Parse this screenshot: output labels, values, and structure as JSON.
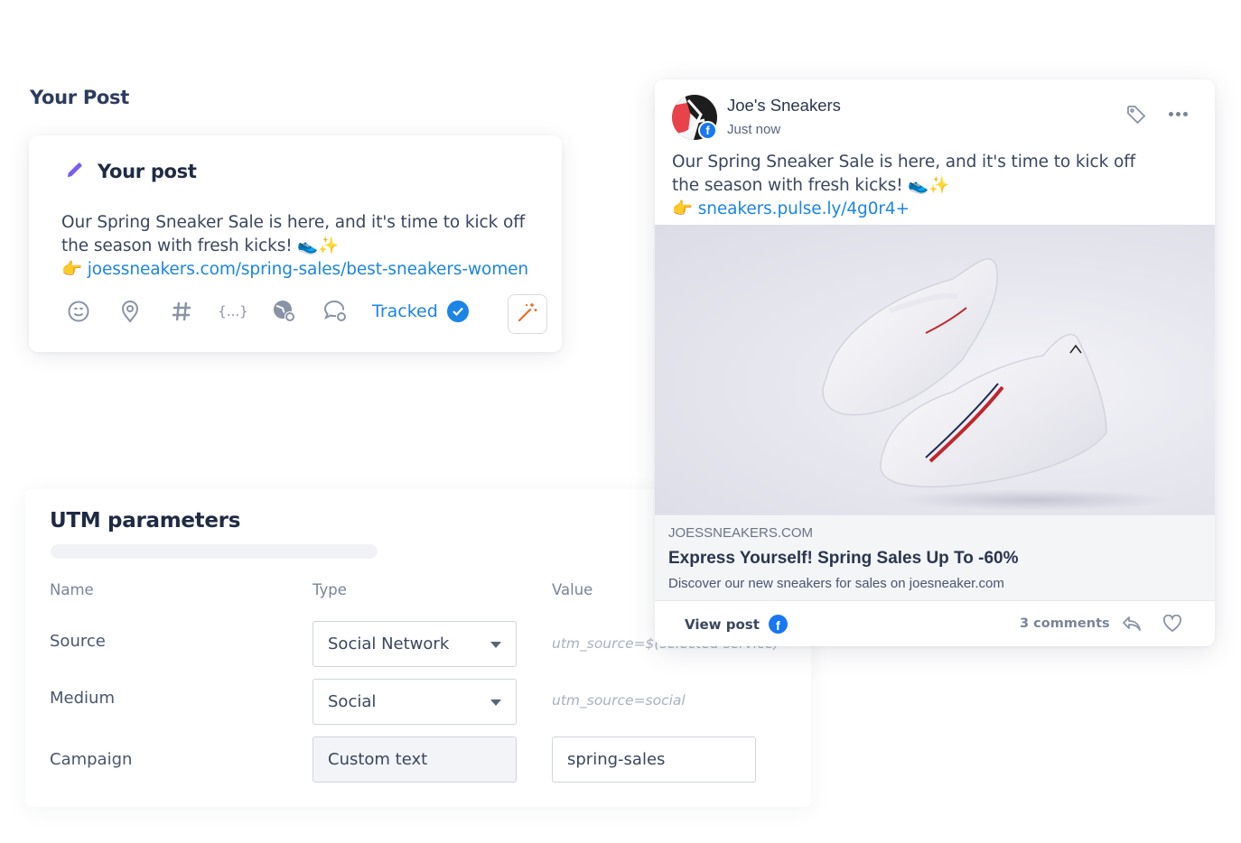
{
  "section": {
    "title": "Your Post"
  },
  "composer": {
    "title": "Your post",
    "text_line1": "Our Spring Sneaker Sale is here, and it's time to kick off",
    "text_line2": "the season with fresh kicks! 👟✨",
    "link_prefix": "👉",
    "link": "joessneakers.com/spring-sales/best-sneakers-women",
    "toolbar": {
      "icons": [
        "emoji-icon",
        "location-icon",
        "hashtag-icon",
        "variables-icon",
        "globe-settings-icon",
        "comment-settings-icon"
      ],
      "variables_glyph": "{...}",
      "hashtag_glyph": "#",
      "tracked_label": "Tracked",
      "magic_button": "magic-wand-icon"
    }
  },
  "utm": {
    "title": "UTM parameters",
    "columns": {
      "name": "Name",
      "type": "Type",
      "value": "Value"
    },
    "rows": [
      {
        "name": "Source",
        "type": "Social Network",
        "value": "utm_source=$(selected service)",
        "value_kind": "hint"
      },
      {
        "name": "Medium",
        "type": "Social",
        "value": "utm_source=social",
        "value_kind": "hint"
      },
      {
        "name": "Campaign",
        "type": "Custom text",
        "value": "spring-sales",
        "value_kind": "input"
      }
    ]
  },
  "preview": {
    "page_name": "Joe's Sneakers",
    "timestamp": "Just now",
    "text_line1": "Our Spring Sneaker Sale is here, and it's time to kick off",
    "text_line2": "the season with fresh kicks! 👟✨",
    "link_prefix": "👉",
    "short_link": "sneakers.pulse.ly/4g0r4+",
    "link_card": {
      "domain": "JOESSNEAKERS.COM",
      "title": "Express Yourself! Spring Sales Up To -60%",
      "description": "Discover our new sneakers for sales on joesneaker.com"
    },
    "footer": {
      "view_post": "View post",
      "comments": "3 comments"
    },
    "brand_color": "#1877f2"
  },
  "colors": {
    "accent": "#1b85e6",
    "pencil": "#7b5cf0",
    "magic": "#f06a1d"
  }
}
